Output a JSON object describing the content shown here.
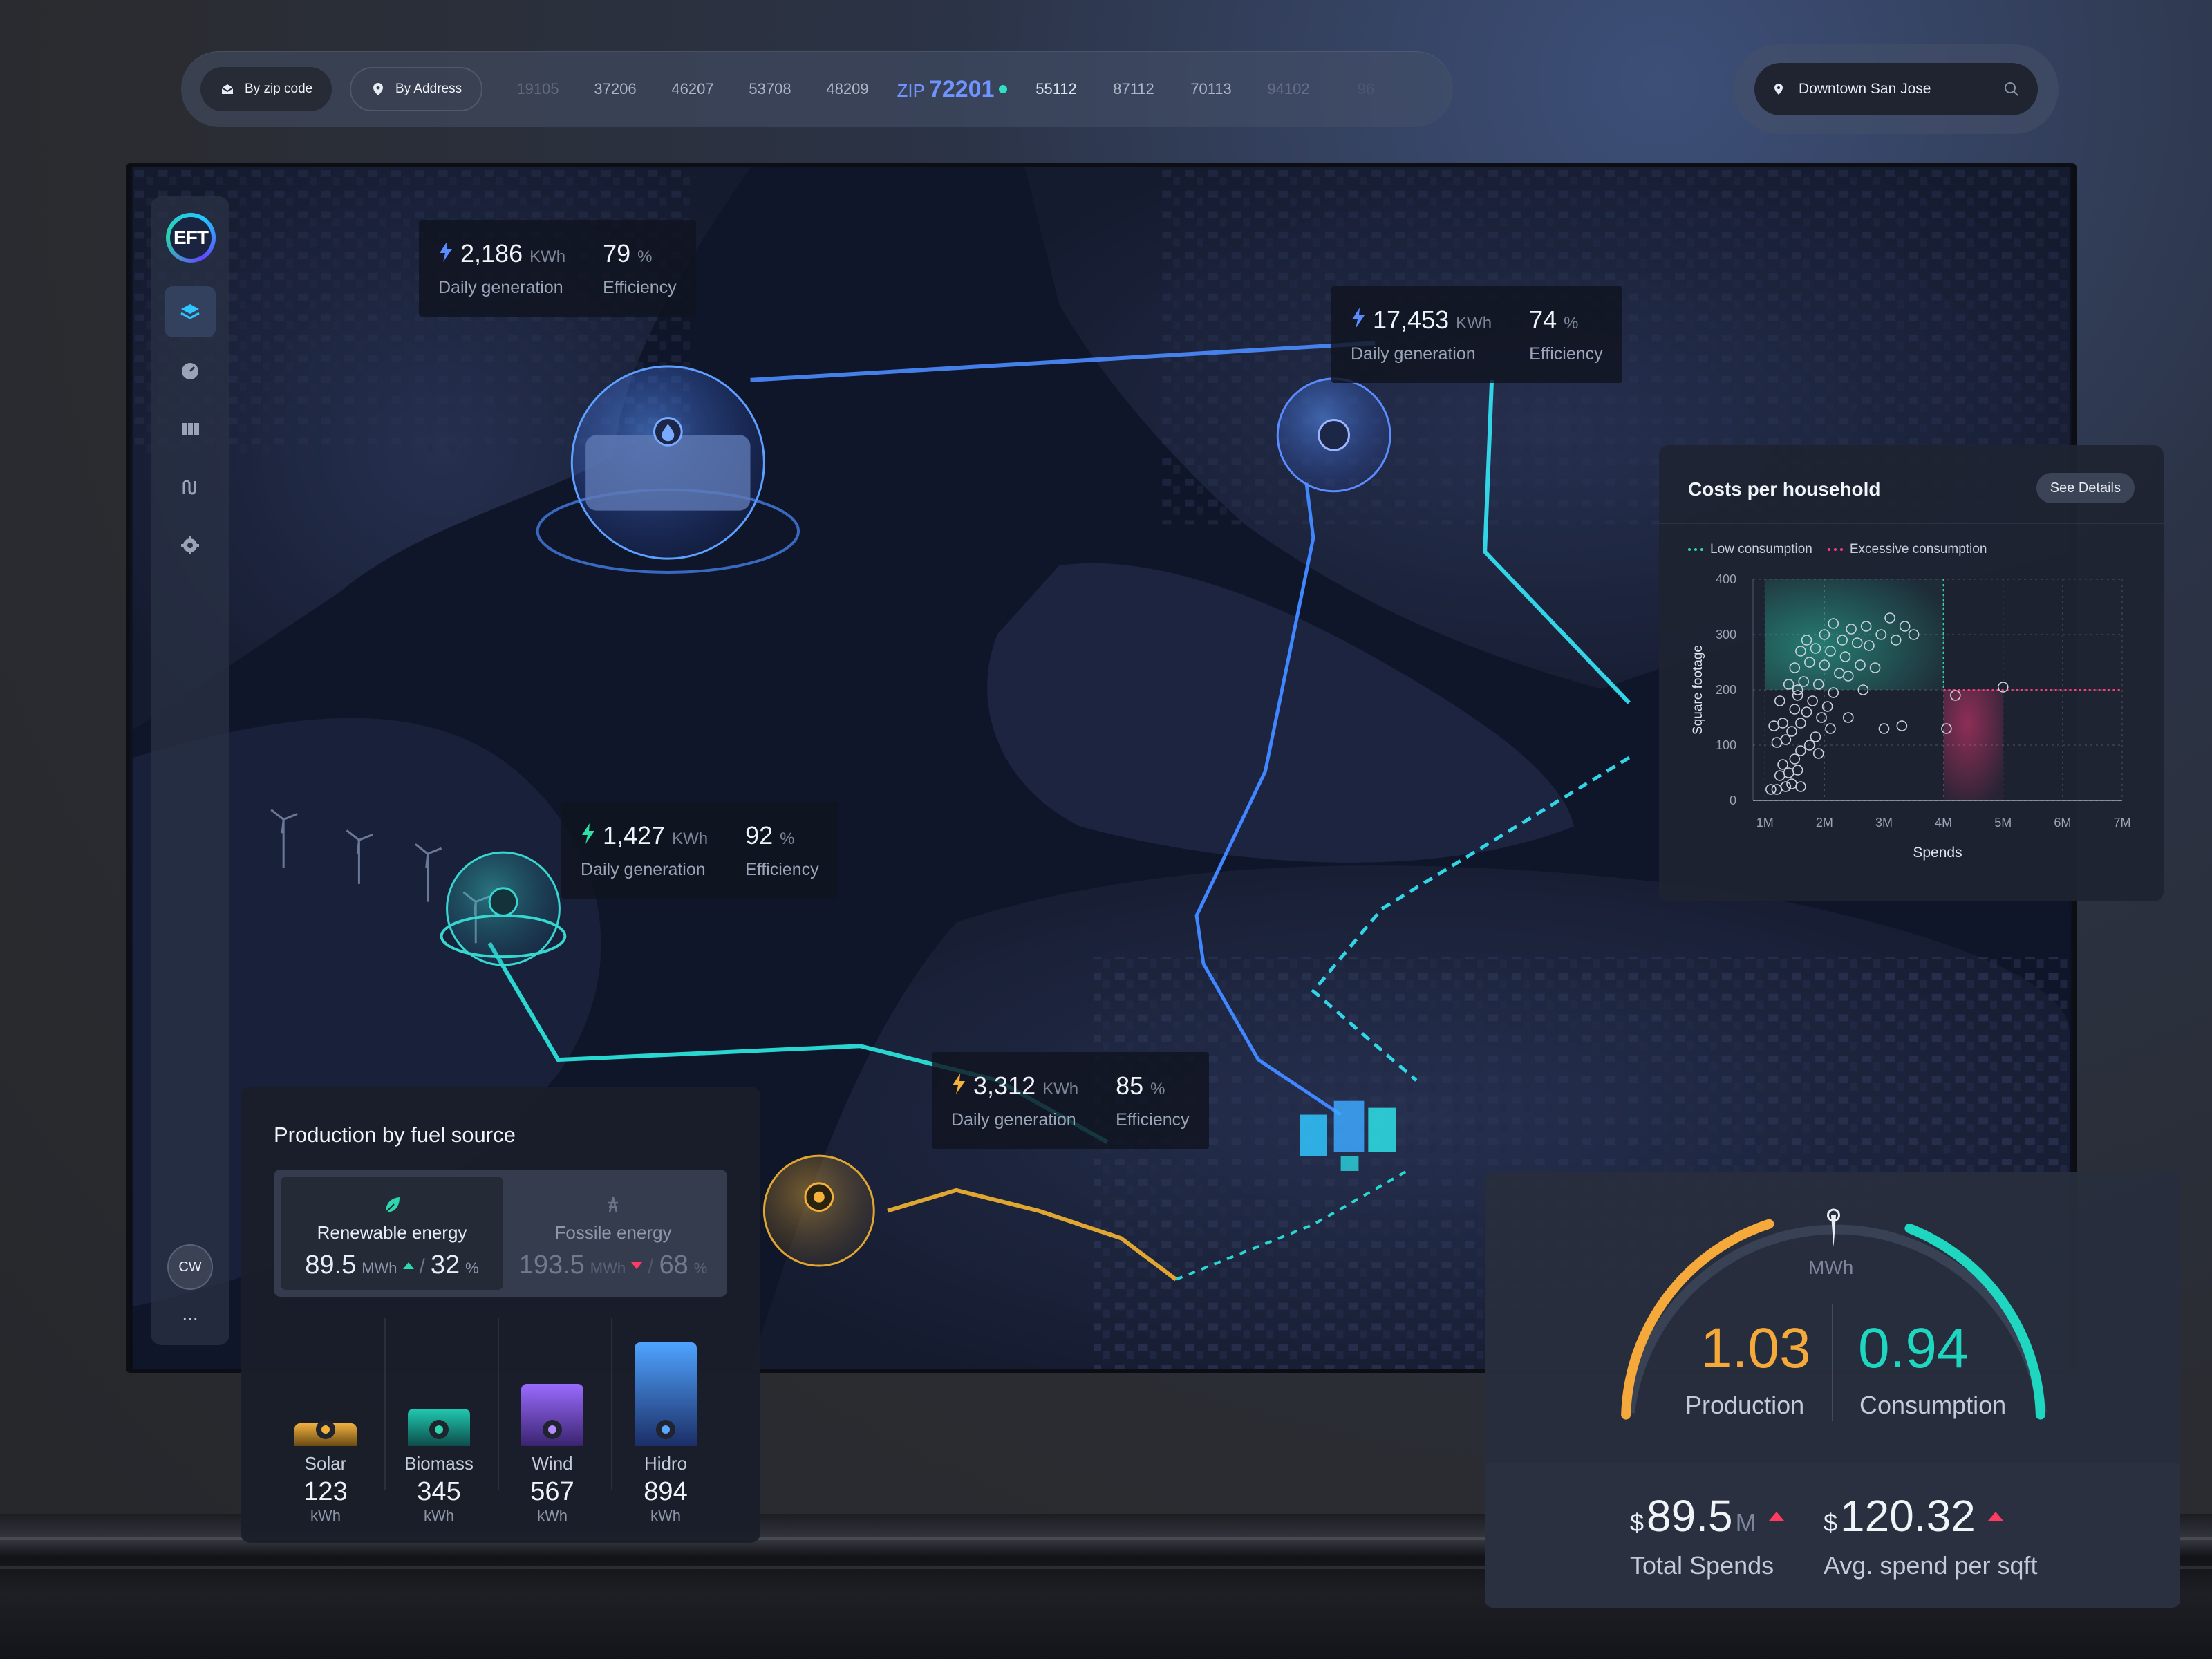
{
  "topbar": {
    "by_zip_label": "By zip code",
    "by_address_label": "By Address",
    "zips_left": [
      "19105",
      "37206",
      "46207",
      "53708",
      "48209"
    ],
    "zip_current_prefix": "ZIP",
    "zip_current": "72201",
    "zips_right": [
      "55112",
      "87112",
      "70113",
      "94102",
      "96"
    ],
    "search_value": "Downtown San Jose"
  },
  "sidebar": {
    "logo_text": "EFT",
    "avatar_initials": "CW",
    "more_label": "..."
  },
  "callouts": [
    {
      "gen": "2,186",
      "gen_unit": "KWh",
      "eff": "79",
      "eff_unit": "%",
      "gen_label": "Daily generation",
      "eff_label": "Efficiency",
      "bolt_color": "#5b8cff"
    },
    {
      "gen": "17,453",
      "gen_unit": "KWh",
      "eff": "74",
      "eff_unit": "%",
      "gen_label": "Daily generation",
      "eff_label": "Efficiency",
      "bolt_color": "#5b8cff"
    },
    {
      "gen": "1,427",
      "gen_unit": "KWh",
      "eff": "92",
      "eff_unit": "%",
      "gen_label": "Daily generation",
      "eff_label": "Efficiency",
      "bolt_color": "#2ee0a6"
    },
    {
      "gen": "3,312",
      "gen_unit": "KWh",
      "eff": "85",
      "eff_unit": "%",
      "gen_label": "Daily generation",
      "eff_label": "Efficiency",
      "bolt_color": "#f4b23a"
    }
  ],
  "costs": {
    "title": "Costs per household",
    "details_label": "See Details",
    "legend_low": "Low consumption",
    "legend_excessive": "Excessive consumption",
    "low_color": "#2ed6b0",
    "excessive_color": "#ff3b7a"
  },
  "chart_data": {
    "type": "scatter",
    "title": "Costs per household",
    "xlabel": "Spends",
    "ylabel": "Square footage",
    "x_ticks": [
      "1M",
      "2M",
      "3M",
      "4M",
      "5M",
      "6M",
      "7M"
    ],
    "y_ticks": [
      "0",
      "100",
      "200",
      "300",
      "400"
    ],
    "xlim": [
      0.8,
      7.0
    ],
    "ylim": [
      0,
      400
    ],
    "grid": true,
    "legend": "top-left",
    "zones": [
      {
        "name": "Low consumption",
        "x": [
          1,
          4
        ],
        "y": [
          200,
          400
        ]
      },
      {
        "name": "Excessive consumption",
        "x": [
          4,
          5
        ],
        "y": [
          0,
          200
        ]
      }
    ],
    "points": [
      [
        1.1,
        20
      ],
      [
        1.2,
        20
      ],
      [
        1.35,
        25
      ],
      [
        1.45,
        30
      ],
      [
        1.6,
        25
      ],
      [
        1.25,
        45
      ],
      [
        1.4,
        50
      ],
      [
        1.55,
        55
      ],
      [
        1.3,
        65
      ],
      [
        1.5,
        75
      ],
      [
        1.2,
        105
      ],
      [
        1.35,
        110
      ],
      [
        1.6,
        90
      ],
      [
        1.75,
        100
      ],
      [
        1.45,
        125
      ],
      [
        1.3,
        140
      ],
      [
        1.6,
        140
      ],
      [
        1.85,
        115
      ],
      [
        1.15,
        135
      ],
      [
        1.5,
        165
      ],
      [
        1.7,
        160
      ],
      [
        1.95,
        150
      ],
      [
        1.25,
        180
      ],
      [
        1.55,
        190
      ],
      [
        1.8,
        180
      ],
      [
        2.05,
        170
      ],
      [
        1.4,
        210
      ],
      [
        1.65,
        215
      ],
      [
        1.9,
        210
      ],
      [
        2.15,
        195
      ],
      [
        1.5,
        240
      ],
      [
        1.75,
        250
      ],
      [
        2.0,
        245
      ],
      [
        2.25,
        230
      ],
      [
        1.6,
        270
      ],
      [
        1.85,
        275
      ],
      [
        2.1,
        270
      ],
      [
        2.35,
        260
      ],
      [
        1.7,
        290
      ],
      [
        2.0,
        300
      ],
      [
        2.3,
        290
      ],
      [
        2.55,
        285
      ],
      [
        2.75,
        280
      ],
      [
        2.15,
        320
      ],
      [
        2.45,
        310
      ],
      [
        2.7,
        315
      ],
      [
        2.95,
        300
      ],
      [
        3.2,
        290
      ],
      [
        1.55,
        200
      ],
      [
        2.4,
        225
      ],
      [
        3.1,
        330
      ],
      [
        3.35,
        315
      ],
      [
        3.5,
        300
      ],
      [
        2.6,
        245
      ],
      [
        2.85,
        240
      ],
      [
        2.1,
        130
      ],
      [
        2.4,
        150
      ],
      [
        3.0,
        130
      ],
      [
        3.3,
        135
      ],
      [
        4.05,
        130
      ],
      [
        4.2,
        190
      ],
      [
        5.0,
        205
      ],
      [
        2.65,
        200
      ],
      [
        1.9,
        85
      ]
    ]
  },
  "production": {
    "title": "Production by fuel source",
    "renewable_label": "Renewable energy",
    "renewable_value": "89.5",
    "renewable_unit": "MWh",
    "renewable_pct": "32",
    "fossil_label": "Fossile energy",
    "fossil_value": "193.5",
    "fossil_unit": "MWh",
    "fossil_pct": "68",
    "pct_unit": "%",
    "sources": [
      {
        "name": "Solar",
        "value": "123",
        "unit": "kWh",
        "level": 0.22,
        "icon": "sun-icon"
      },
      {
        "name": "Biomass",
        "value": "345",
        "unit": "kWh",
        "level": 0.36,
        "icon": "biomass-icon"
      },
      {
        "name": "Wind",
        "value": "567",
        "unit": "kWh",
        "level": 0.6,
        "icon": "wind-icon"
      },
      {
        "name": "Hidro",
        "value": "894",
        "unit": "kWh",
        "level": 1.0,
        "icon": "water-drop-icon"
      }
    ]
  },
  "gauge": {
    "unit": "MWh",
    "production_value": "1.03",
    "production_label": "Production",
    "consumption_value": "0.94",
    "consumption_label": "Consumption",
    "production_color": "#f4a93a",
    "consumption_color": "#1fd6c0",
    "total_spends_currency": "$",
    "total_spends": "89.5",
    "total_spends_suffix": "M",
    "total_spends_label": "Total Spends",
    "avg_spend_currency": "$",
    "avg_spend": "120.32",
    "avg_spend_label": "Avg. spend per sqft"
  }
}
